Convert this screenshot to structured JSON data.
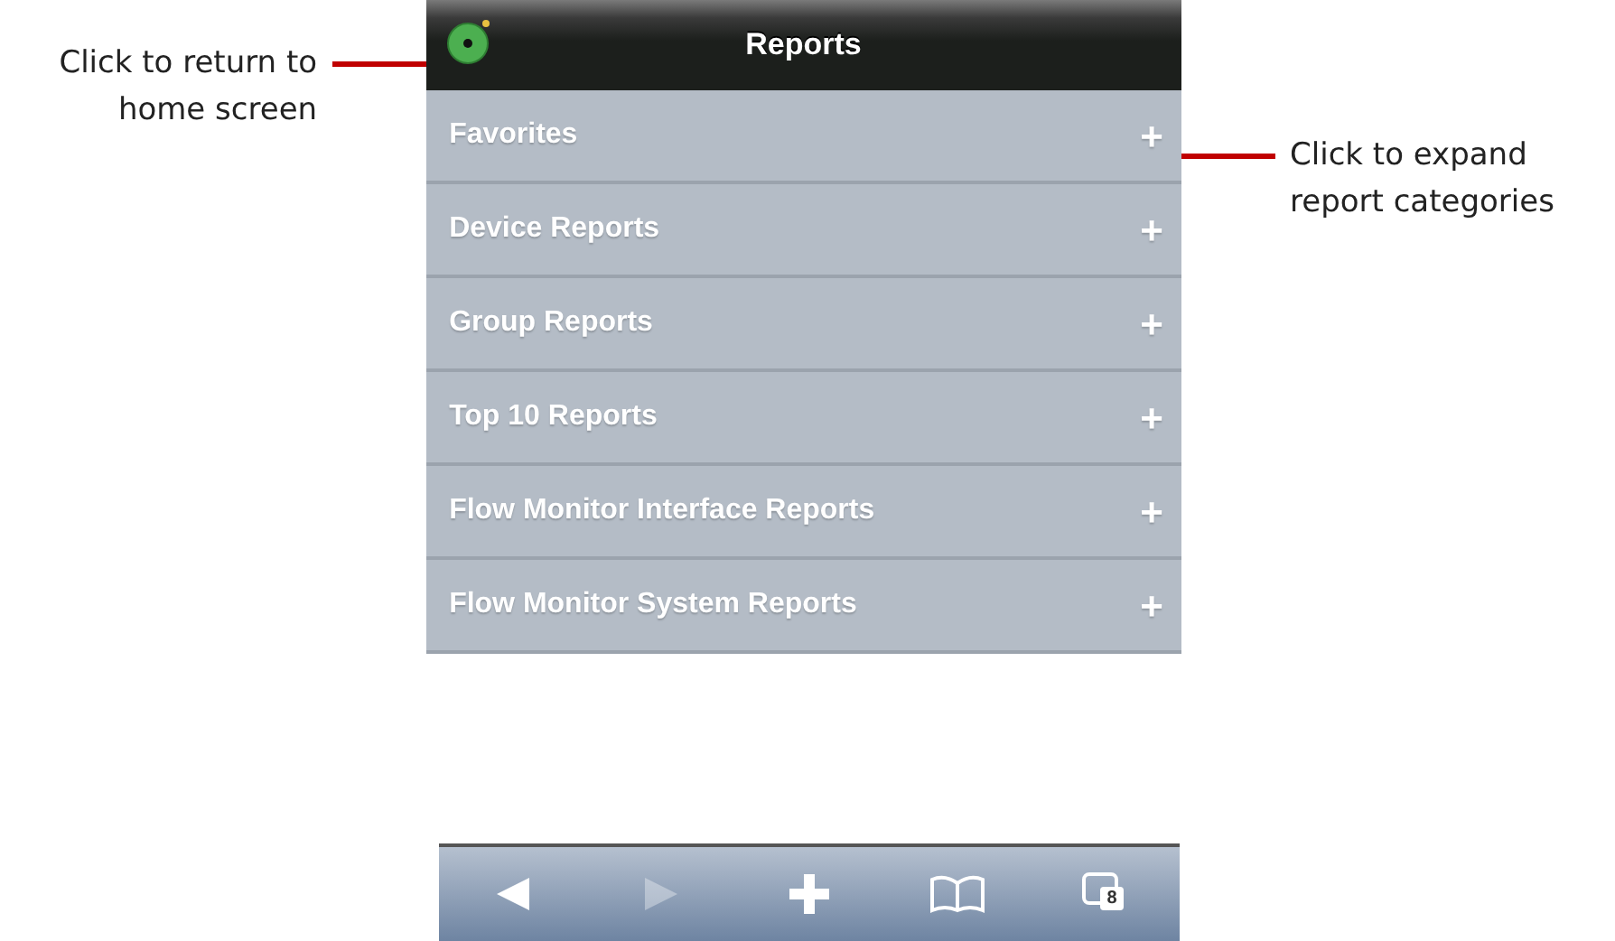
{
  "callouts": [
    {
      "text": "Click to return to home screen"
    },
    {
      "text": "Click to expand report categories"
    }
  ],
  "header": {
    "title": "Reports"
  },
  "report_categories": [
    {
      "label": "Favorites",
      "expand_symbol": "+"
    },
    {
      "label": "Device Reports",
      "expand_symbol": "+"
    },
    {
      "label": "Group Reports",
      "expand_symbol": "+"
    },
    {
      "label": "Top 10 Reports",
      "expand_symbol": "+"
    },
    {
      "label": "Flow Monitor Interface Reports",
      "expand_symbol": "+"
    },
    {
      "label": "Flow Monitor System Reports",
      "expand_symbol": "+"
    }
  ],
  "browser_toolbar": {
    "buttons": [
      {
        "kind": "back",
        "disabled": false
      },
      {
        "kind": "forward",
        "disabled": true
      },
      {
        "kind": "add",
        "disabled": false
      },
      {
        "kind": "bookmarks",
        "disabled": false
      },
      {
        "kind": "tabs",
        "disabled": false,
        "count": "8"
      }
    ]
  }
}
